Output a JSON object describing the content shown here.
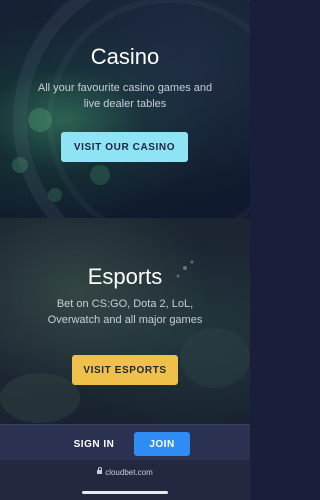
{
  "casino": {
    "title": "Casino",
    "subtitle": "All your favourite casino games and live dealer tables",
    "button_label": "VISIT OUR CASINO"
  },
  "esports": {
    "title": "Esports",
    "subtitle": "Bet on CS:GO, Dota 2, LoL, Overwatch and all major games",
    "button_label": "VISIT ESPORTS"
  },
  "auth": {
    "sign_in_label": "SIGN IN",
    "join_label": "JOIN"
  },
  "browser": {
    "url": "cloudbet.com"
  },
  "colors": {
    "casino_button": "#8ee3f5",
    "esports_button": "#f0c14a",
    "join_button": "#2f8cf5",
    "bottom_bar": "#2b3150"
  }
}
